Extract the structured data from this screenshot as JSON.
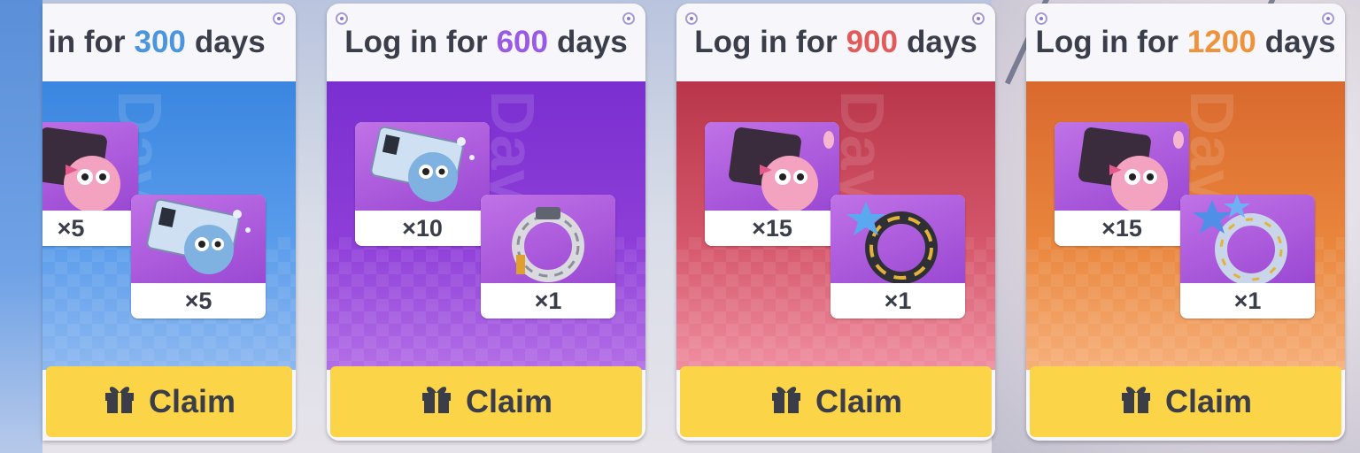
{
  "colors": {
    "claim_bg": "#fbd448",
    "text_dark": "#3a3d4a",
    "card_300_accent": "#4b95de",
    "card_600_accent": "#9a5ae8",
    "card_900_accent": "#e25a5a",
    "card_1200_accent": "#f0923a"
  },
  "cards": [
    {
      "header_prefix": "in for",
      "header_lead": "",
      "days": "300",
      "header_suffix": "days",
      "body_gradient": "blue",
      "items": [
        {
          "icon": "pink-creature-ticket-icon",
          "qty": "×5"
        },
        {
          "icon": "blue-creature-ticket-icon",
          "qty": "×5"
        }
      ],
      "claim_label": "Claim",
      "claim_icon": "gift-icon"
    },
    {
      "header_prefix": "in for",
      "header_lead": "Log",
      "days": "600",
      "header_suffix": "days",
      "body_gradient": "purple",
      "items": [
        {
          "icon": "blue-creature-ticket-icon",
          "qty": "×10"
        },
        {
          "icon": "silver-ring-icon",
          "qty": "×1"
        }
      ],
      "claim_label": "Claim",
      "claim_icon": "gift-icon"
    },
    {
      "header_prefix": "in for",
      "header_lead": "Log",
      "days": "900",
      "header_suffix": "days",
      "body_gradient": "red",
      "items": [
        {
          "icon": "pink-creature-ticket-icon",
          "qty": "×15"
        },
        {
          "icon": "star-gold-ring-icon",
          "qty": "×1"
        }
      ],
      "claim_label": "Claim",
      "claim_icon": "gift-icon"
    },
    {
      "header_prefix": "in for",
      "header_lead": "Log",
      "days": "1200",
      "header_suffix": "days",
      "body_gradient": "orange",
      "items": [
        {
          "icon": "pink-creature-ticket-icon",
          "qty": "×15"
        },
        {
          "icon": "star-crystal-ring-icon",
          "qty": "×1"
        }
      ],
      "claim_label": "Claim",
      "claim_icon": "gift-icon"
    }
  ]
}
